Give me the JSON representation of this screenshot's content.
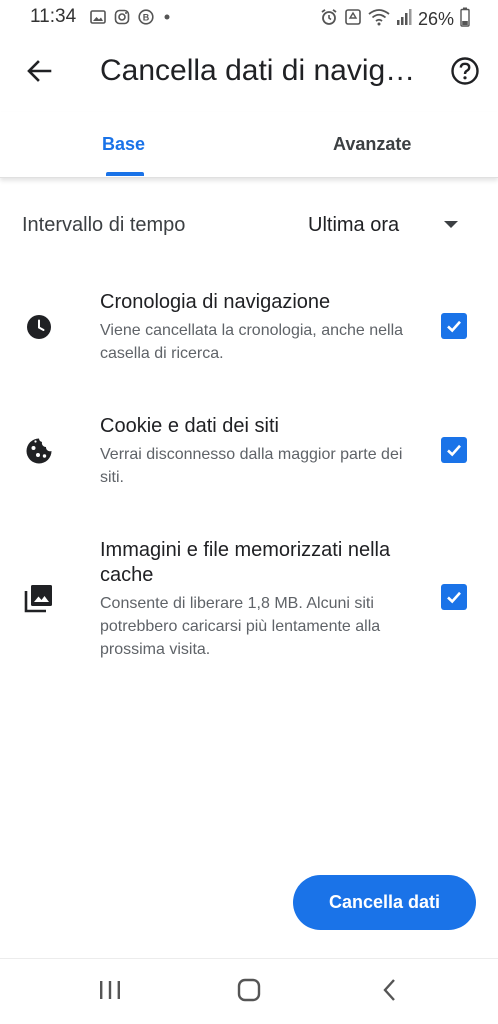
{
  "status_bar": {
    "time": "11:34",
    "battery_percent": "26%",
    "left_icons": [
      "image-icon",
      "instagram-icon",
      "b-badge-icon",
      "dot-icon"
    ],
    "right_icons": [
      "alarm-icon",
      "recycle-icon",
      "wifi-icon",
      "signal-icon",
      "battery-icon"
    ]
  },
  "toolbar": {
    "title": "Cancella dati di navig…",
    "back_icon": "arrow-back-icon",
    "help_icon": "help-icon"
  },
  "tabs": {
    "items": [
      {
        "label": "Base",
        "selected": true
      },
      {
        "label": "Avanzate",
        "selected": false
      }
    ]
  },
  "time_range": {
    "label": "Intervallo di tempo",
    "value": "Ultima ora"
  },
  "options": [
    {
      "icon": "clock-icon",
      "title": "Cronologia di navigazione",
      "description": "Viene cancellata la cronologia, anche nella casella di ricerca.",
      "checked": true
    },
    {
      "icon": "cookie-icon",
      "title": "Cookie e dati dei siti",
      "description": "Verrai disconnesso dalla maggior parte dei siti.",
      "checked": true
    },
    {
      "icon": "images-icon",
      "title": "Immagini e file memorizzati nella cache",
      "description": "Consente di liberare 1,8 MB. Alcuni siti potrebbero caricarsi più lentamente alla prossima visita.",
      "checked": true
    }
  ],
  "primary_button": {
    "label": "Cancella dati"
  },
  "colors": {
    "accent": "#1a73e8",
    "text_primary": "#202124",
    "text_secondary": "#5f6368"
  },
  "nav_bar": {
    "items": [
      "recents-icon",
      "home-icon",
      "back-icon"
    ]
  }
}
